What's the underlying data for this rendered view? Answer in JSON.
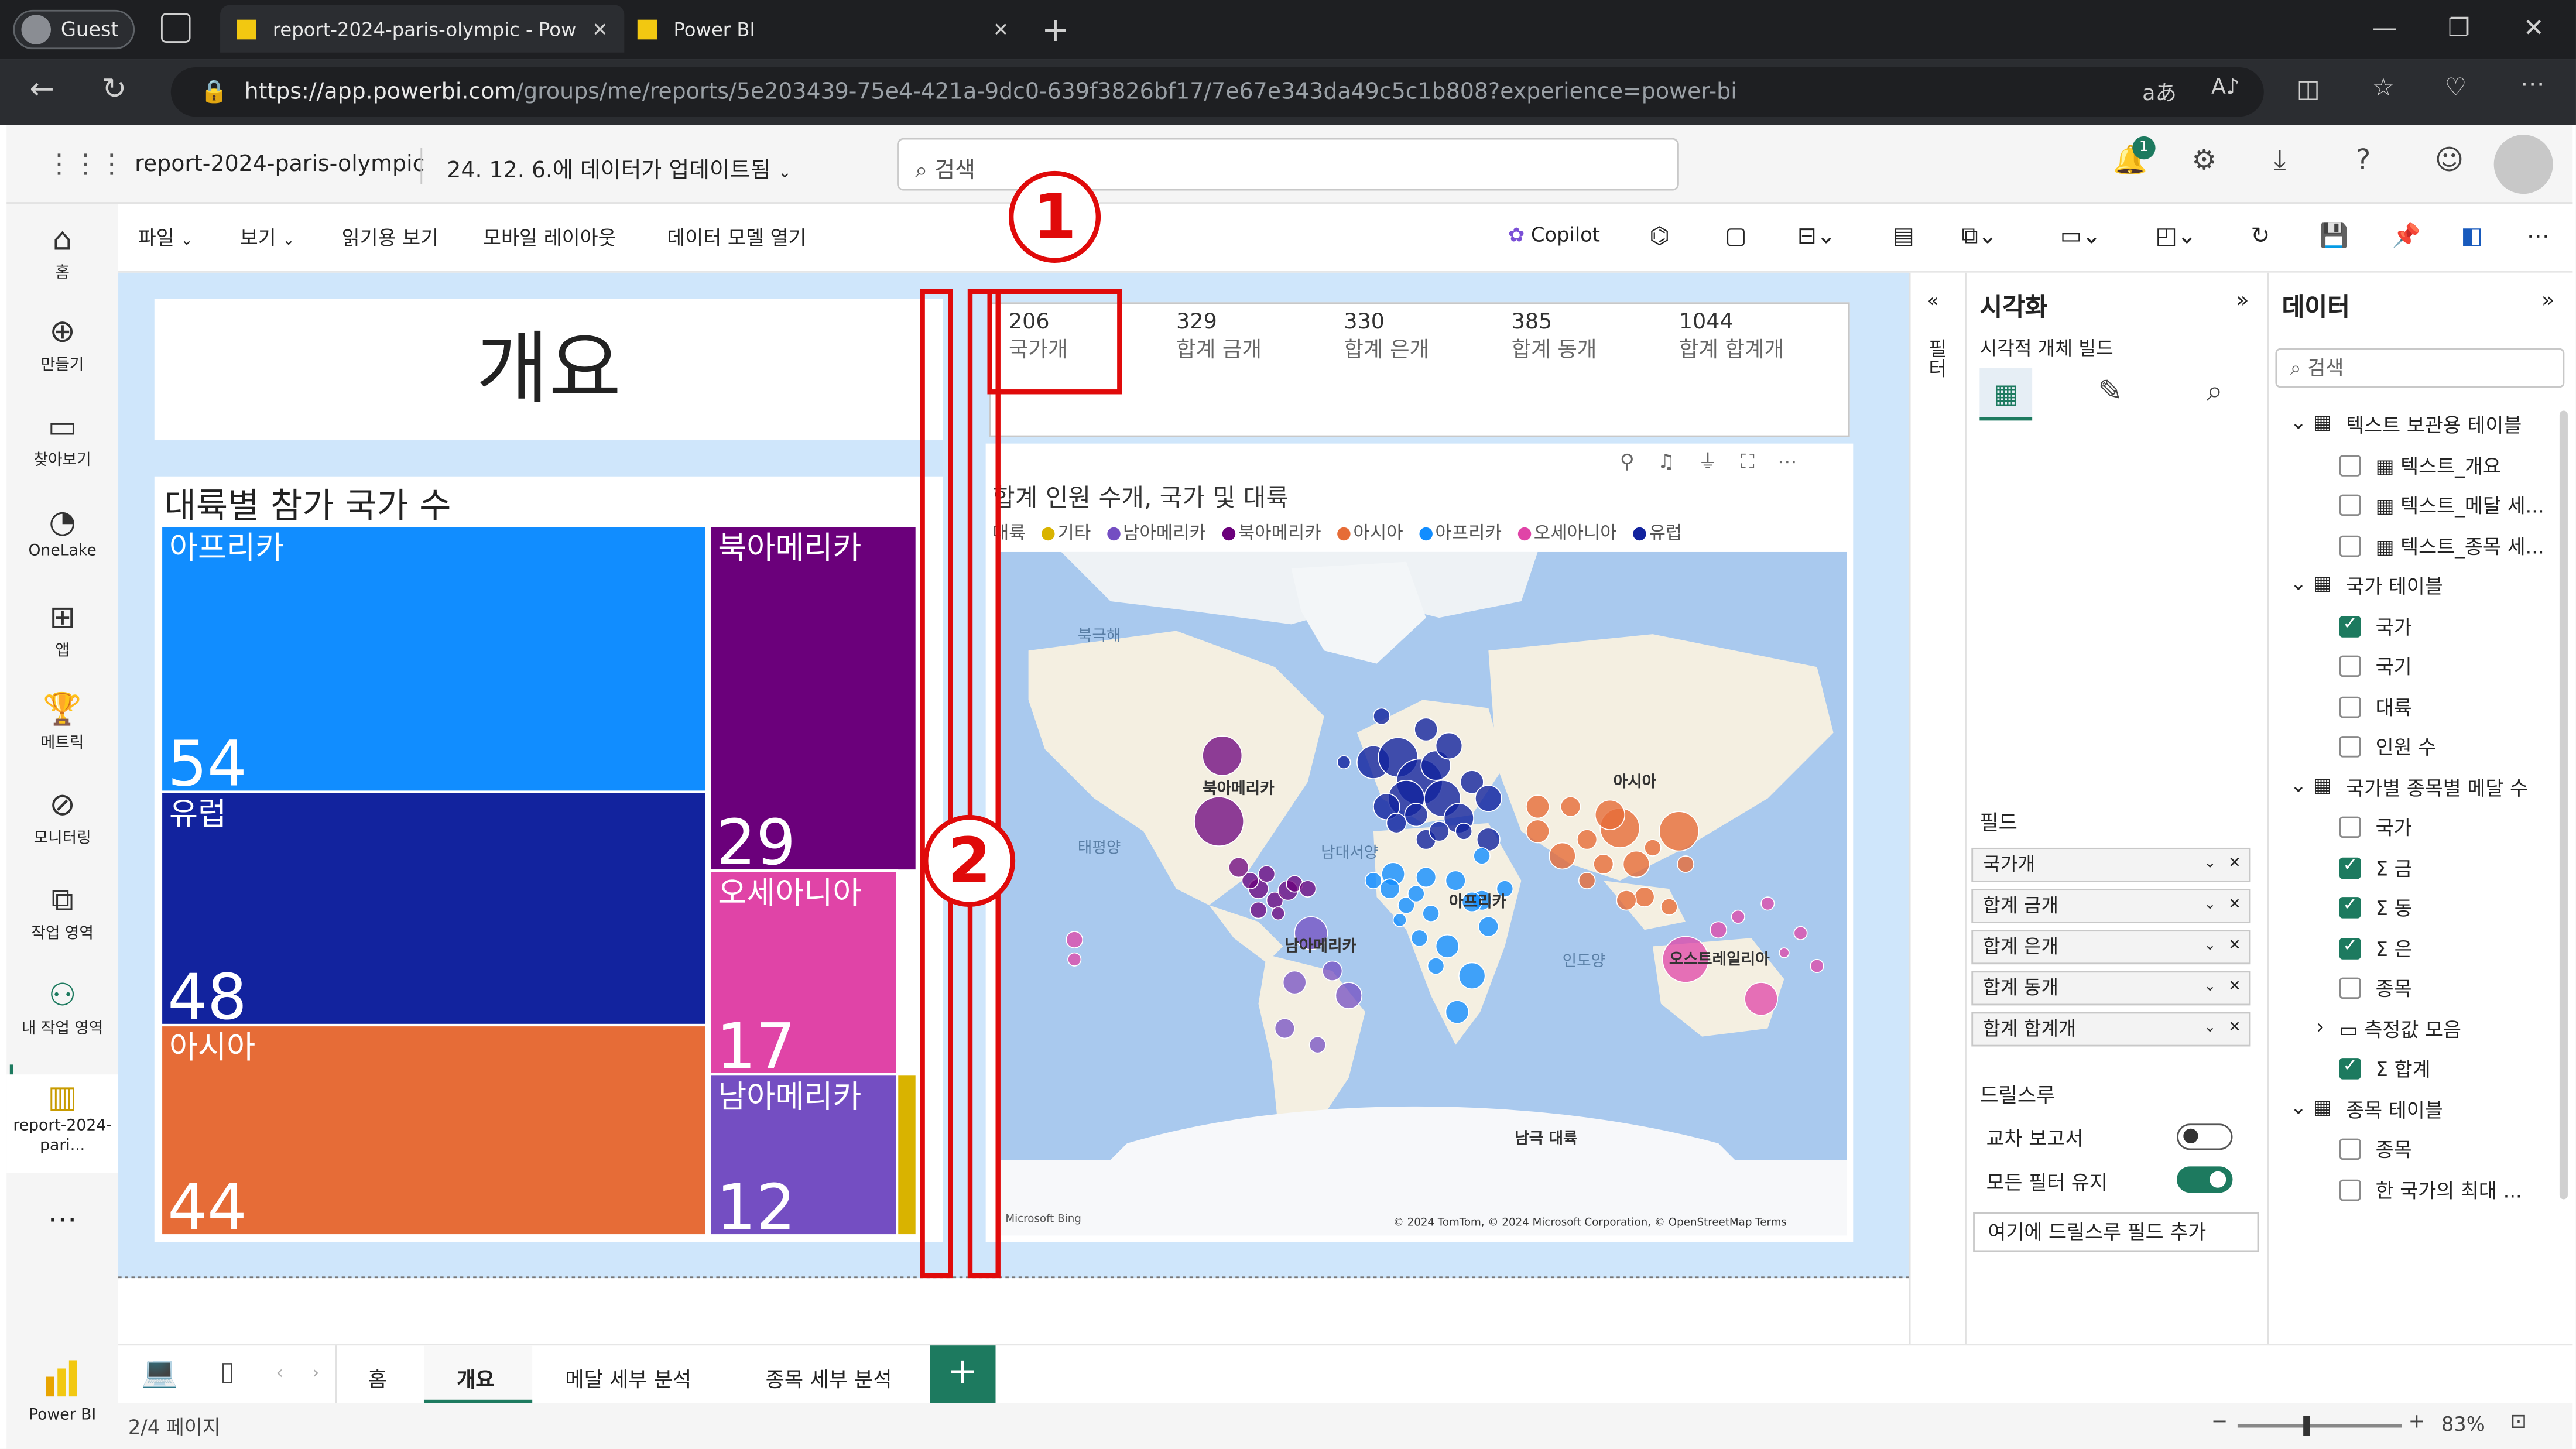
{
  "browser": {
    "profile": "Guest",
    "tabs": [
      {
        "title": "report-2024-paris-olympic - Pow",
        "active": true
      },
      {
        "title": "Power BI",
        "active": false
      }
    ],
    "url_host": "https://app.powerbi.com",
    "url_path": "/groups/me/reports/5e203439-75e4-421a-9dc0-639f3826bf17/7e67e343da49c5c1b808?experience=power-bi"
  },
  "header": {
    "report_name": "report-2024-paris-olympic",
    "updated": "24. 12. 6.에 데이터가 업데이트됨",
    "search_placeholder": "검색",
    "notification_count": "1"
  },
  "leftnav": [
    {
      "label": "홈",
      "icon": "home-icon"
    },
    {
      "label": "만들기",
      "icon": "create-icon"
    },
    {
      "label": "찾아보기",
      "icon": "browse-icon"
    },
    {
      "label": "OneLake",
      "icon": "onelake-icon"
    },
    {
      "label": "앱",
      "icon": "apps-icon"
    },
    {
      "label": "메트릭",
      "icon": "metrics-icon"
    },
    {
      "label": "모니터링",
      "icon": "monitor-icon"
    },
    {
      "label": "작업 영역",
      "icon": "workspaces-icon"
    },
    {
      "label": "내 작업 영역",
      "icon": "my-workspace-icon"
    },
    {
      "label": "report-2024-pari...",
      "icon": "report-icon"
    }
  ],
  "powerbi_label": "Power BI",
  "ribbon": {
    "items": [
      "파일",
      "보기",
      "읽기용 보기",
      "모바일 레이아웃",
      "데이터 모델 열기"
    ],
    "copilot": "Copilot"
  },
  "report": {
    "title": "개요",
    "kpis": [
      {
        "value": "206",
        "label": "국가개"
      },
      {
        "value": "329",
        "label": "합계 금개"
      },
      {
        "value": "330",
        "label": "합계 은개"
      },
      {
        "value": "385",
        "label": "합계 동개"
      },
      {
        "value": "1044",
        "label": "합계 합계개"
      }
    ],
    "treemap": {
      "title": "대륙별 참가 국가 수",
      "items": [
        {
          "name": "아프리카",
          "value": "54",
          "color": "#118dff"
        },
        {
          "name": "유럽",
          "value": "48",
          "color": "#12239e"
        },
        {
          "name": "아시아",
          "value": "44",
          "color": "#e66c37"
        },
        {
          "name": "북아메리카",
          "value": "29",
          "color": "#6b007b"
        },
        {
          "name": "오세아니아",
          "value": "17",
          "color": "#e044a7"
        },
        {
          "name": "남아메리카",
          "value": "12",
          "color": "#744ec2"
        },
        {
          "name": "기타",
          "value": "",
          "color": "#d9b300"
        }
      ]
    },
    "map": {
      "title": "합계 인원 수개, 국가 및 대륙",
      "legend_title": "대륙",
      "legend": [
        {
          "name": "기타",
          "color": "#d9b300"
        },
        {
          "name": "남아메리카",
          "color": "#744ec2"
        },
        {
          "name": "북아메리카",
          "color": "#6b007b"
        },
        {
          "name": "아시아",
          "color": "#e66c37"
        },
        {
          "name": "아프리카",
          "color": "#118dff"
        },
        {
          "name": "오세아니아",
          "color": "#e044a7"
        },
        {
          "name": "유럽",
          "color": "#12239e"
        }
      ],
      "labels": {
        "north_sea": "북극해",
        "north_america": "북아메리카",
        "pacific": "태평양",
        "atlantic": "남대서양",
        "asia": "아시아",
        "africa": "아프리카",
        "south_america": "남아메리카",
        "indian": "인도양",
        "australia": "오스트레일리아",
        "antarctica": "남극 대륙"
      },
      "attribution": "© 2024 TomTom, © 2024 Microsoft Corporation, © OpenStreetMap  Terms",
      "bing": "Microsoft Bing"
    }
  },
  "visualizations": {
    "title": "시각화",
    "build": "시각적 개체 빌드",
    "fields_label": "필드",
    "fields": [
      "국가개",
      "합계 금개",
      "합계 은개",
      "합계 동개",
      "합계 합계개"
    ],
    "drillthrough": "드릴스루",
    "cross_report": "교차 보고서",
    "keep_filters": "모든 필터 유지",
    "add_drill": "여기에 드릴스루 필드 추가"
  },
  "data": {
    "title": "데이터",
    "search_placeholder": "검색",
    "tables": [
      {
        "name": "텍스트 보관용 테이블",
        "fields": [
          {
            "name": "텍스트_개요",
            "checked": false
          },
          {
            "name": "텍스트_메달 세...",
            "checked": false
          },
          {
            "name": "텍스트_종목 세...",
            "checked": false
          }
        ]
      },
      {
        "name": "국가 테이블",
        "fields": [
          {
            "name": "국가",
            "checked": true
          },
          {
            "name": "국기",
            "checked": false
          },
          {
            "name": "대륙",
            "checked": false
          },
          {
            "name": "인원 수",
            "checked": false
          }
        ]
      },
      {
        "name": "국가별 종목별 메달 수",
        "fields": [
          {
            "name": "국가",
            "checked": false
          },
          {
            "name": "금",
            "checked": true
          },
          {
            "name": "동",
            "checked": true
          },
          {
            "name": "은",
            "checked": true
          },
          {
            "name": "종목",
            "checked": false
          },
          {
            "name": "측정값 모음",
            "checked": false
          },
          {
            "name": "합계",
            "checked": true
          }
        ]
      },
      {
        "name": "종목 테이블",
        "fields": [
          {
            "name": "종목",
            "checked": false
          },
          {
            "name": "한 국가의 최대 ...",
            "checked": false
          }
        ]
      }
    ]
  },
  "pages": {
    "tabs": [
      "홈",
      "개요",
      "메달 세부 분석",
      "종목 세부 분석"
    ],
    "active": "개요",
    "counter": "2/4 페이지",
    "zoom": "83%"
  },
  "annotations": [
    "1",
    "2"
  ]
}
